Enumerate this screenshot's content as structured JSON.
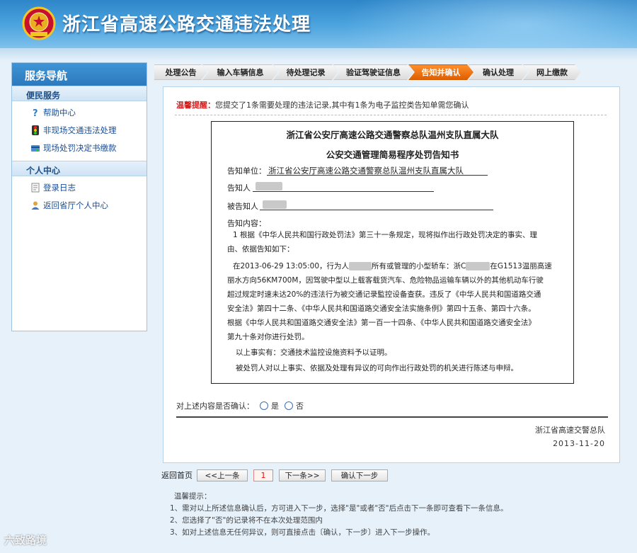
{
  "header": {
    "title": "浙江省高速公路交通违法处理",
    "emblem_icon": "police-emblem-icon",
    "colors": {
      "primary": "#2e86c9",
      "accent": "#e05f00",
      "warning": "#d41c1c"
    }
  },
  "sidebar": {
    "title": "服务导航",
    "sections": [
      {
        "title": "便民服务",
        "items": [
          {
            "label": "帮助中心",
            "icon": "question-icon"
          },
          {
            "label": "非现场交通违法处理",
            "icon": "traffic-light-icon"
          },
          {
            "label": "现场处罚决定书缴款",
            "icon": "payment-icon"
          }
        ]
      },
      {
        "title": "个人中心",
        "items": [
          {
            "label": "登录日志",
            "icon": "log-icon"
          },
          {
            "label": "返回省厅个人中心",
            "icon": "user-icon"
          }
        ]
      }
    ]
  },
  "steps": [
    {
      "label": "处理公告",
      "active": false
    },
    {
      "label": "输入车辆信息",
      "active": false
    },
    {
      "label": "待处理记录",
      "active": false
    },
    {
      "label": "验证驾驶证信息",
      "active": false
    },
    {
      "label": "告知并确认",
      "active": true
    },
    {
      "label": "确认处理",
      "active": false
    },
    {
      "label": "网上缴款",
      "active": false
    }
  ],
  "notice": {
    "label": "温馨提醒：",
    "text": "您提交了1条需要处理的违法记录,其中有1条为电子监控类告知单需您确认"
  },
  "doc": {
    "title1": "浙江省公安厅高速公路交通警察总队温州支队直属大队",
    "title2": "公安交通管理简易程序处罚告知书",
    "unit_label": "告知单位：",
    "unit_value": "浙江省公安厅高速公路交通警察总队温州支队直属大队",
    "notifier_label": "告知人",
    "notified_label": "被告知人",
    "content_label": "告知内容：",
    "p1a": "1 根据《中华人民共和国行政处罚法》第三十一条规定，现将拟作出行政处罚决定的事实、理",
    "p1b": "由、依据告知如下：",
    "p2a_1": "在2013-06-29 13:05:00，行为人",
    "p2a_2": "所有或管理的小型轿车：浙C",
    "p2a_3": "在G1513温丽高速",
    "p2b": "丽水方向56KM700M，因驾驶中型以上载客载货汽车、危险物品运输车辆以外的其他机动车行驶",
    "p2c": "超过规定时速未达20%的违法行为被交通记录監控设备查获。违反了《中华人民共和国道路交通",
    "p2d": "安全法》第四十二条、《中华人民共和国道路交通安全法实施条例》第四十五条、第四十六条。",
    "p2e": "根据《中华人民共和国道路交通安全法》第一百一十四条、《中华人民共和国道路交通安全法》",
    "p2f": "第九十条对你进行处罚。",
    "p3": "以上事实有：交通技术监控设施资料予以证明。",
    "p4": "被处罚人对以上事实、依据及处理有异议的可向作出行政处罚的机关进行陈述与申辩。"
  },
  "confirm": {
    "question": "对上述内容是否确认：",
    "yes": "是",
    "no": "否"
  },
  "signature": {
    "org": "浙江省高速交警总队",
    "date": "2013-11-20"
  },
  "pager": {
    "home": "返回首页",
    "prev": "<<上一条",
    "current": "1",
    "next": "下一条>>",
    "confirm_next": "确认下一步"
  },
  "tips": {
    "title": "温馨提示：",
    "items": [
      "1、需对以上所述信息确认后，方可进入下一步，选择\"是\"或者\"否\"后点击下一条即可查看下一条信息。",
      "2、您选择了\"否\"的记录将不在本次处理范围内",
      "3、如对上述信息无任何异议，则可直接点击〔确认，下一步〕进入下一步操作。"
    ]
  },
  "watermark": "六致路境"
}
